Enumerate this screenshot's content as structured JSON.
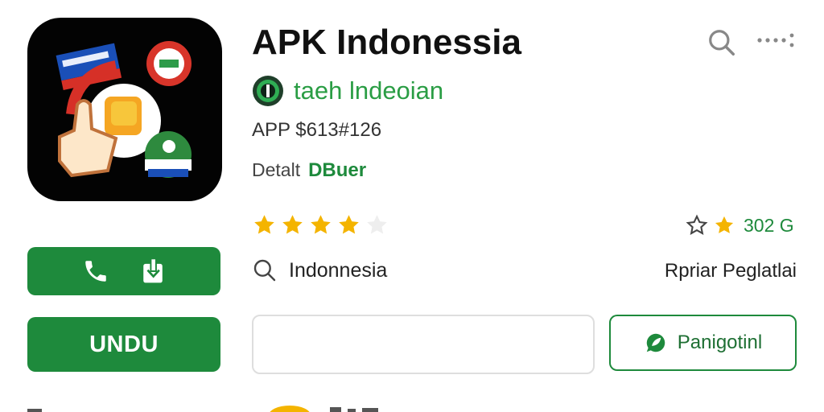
{
  "app": {
    "title": "APK Indonessia",
    "developer": "taeh lndeoian",
    "meta": "APP $613#126",
    "detail_label": "Detalt",
    "detail_value": "DBuer",
    "rating_value": "302 G",
    "stars_filled": 4,
    "stars_total": 5,
    "region": "Indonnesia",
    "action_link": "Rpriar Peglatlai"
  },
  "buttons": {
    "download_label": "UNDU",
    "outline_label": "Panigotinl"
  },
  "input": {
    "value": "",
    "placeholder": ""
  },
  "icons": {
    "top_search": "search-icon",
    "top_more": "more-icon",
    "call": "phone-icon",
    "save": "download-icon",
    "region": "search-icon",
    "outline_button": "chat-leaf-icon",
    "favorite": "star-outline-icon"
  },
  "colors": {
    "accent": "#1e8a3c",
    "star": "#f4b400",
    "developer_text": "#2a9d44",
    "icon_background": "#030303"
  }
}
